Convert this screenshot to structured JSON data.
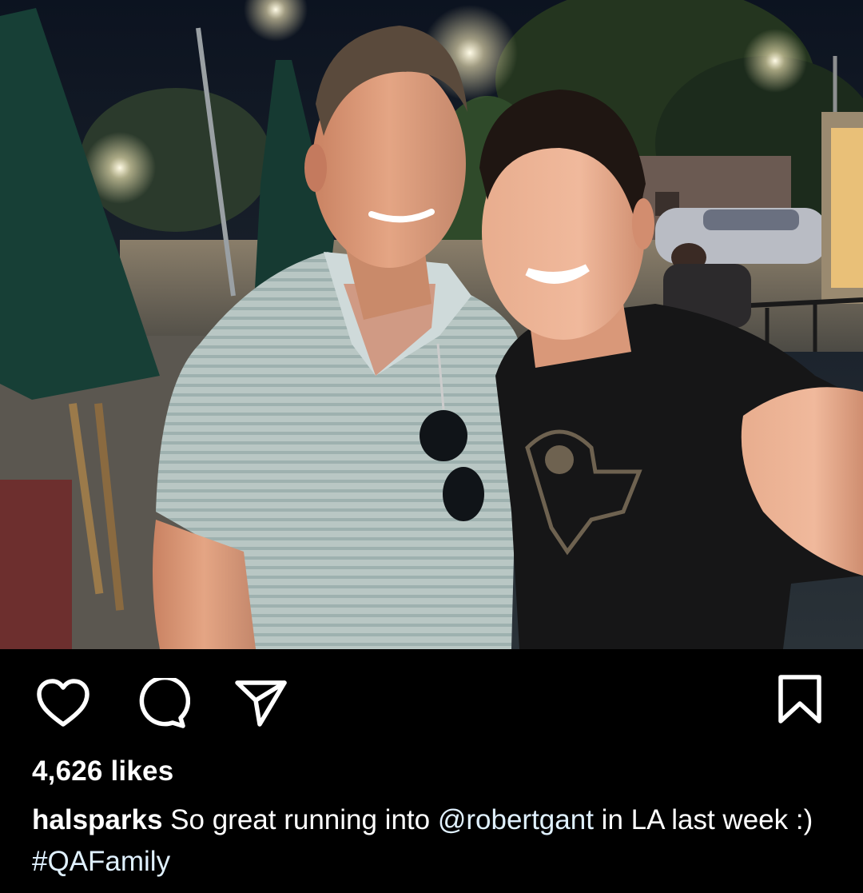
{
  "post": {
    "image_alt": "Two men smiling for a selfie outdoors at night",
    "likes_text": "4,626 likes",
    "caption": {
      "username": "halsparks",
      "text_before": " So great running into ",
      "mention": "@robertgant",
      "text_middle": " in LA last week :) ",
      "hashtag": "#QAFamily"
    }
  },
  "actions": {
    "like_icon": "heart-icon",
    "comment_icon": "comment-icon",
    "share_icon": "paper-plane-icon",
    "save_icon": "bookmark-icon"
  },
  "colors": {
    "background": "#000000",
    "text": "#ffffff",
    "link": "#e0f1ff"
  }
}
